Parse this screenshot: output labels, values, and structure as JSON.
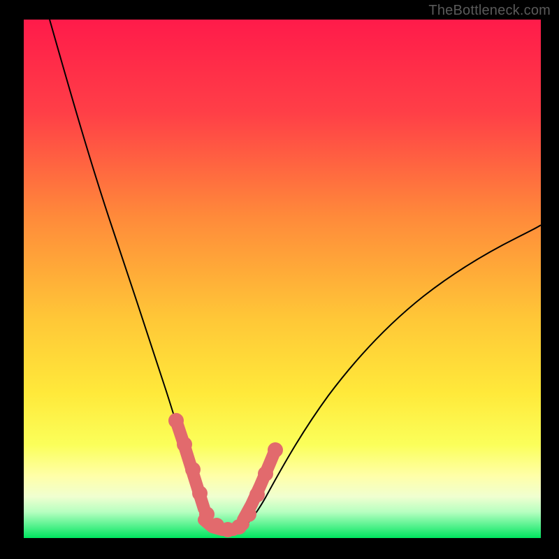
{
  "watermark": "TheBottleneck.com",
  "colors": {
    "gradient_top": "#ff1b4a",
    "gradient_mid_upper": "#ff8a3a",
    "gradient_mid": "#ffde35",
    "gradient_lower_yellow": "#ffff8a",
    "gradient_green_pale": "#b6ffc0",
    "gradient_green": "#00e55f",
    "curve": "#000000",
    "overlay": "#e26a6d",
    "frame": "#000000"
  },
  "chart_data": {
    "type": "line",
    "title": "",
    "xlabel": "",
    "ylabel": "",
    "x_range": [
      0,
      100
    ],
    "y_range": [
      0,
      100
    ],
    "note": "Bottleneck-style V curve. y≈100 is top (red, high bottleneck), y≈0 is bottom (green, no bottleneck). Minimum around x≈37.",
    "series": [
      {
        "name": "bottleneck_curve",
        "x": [
          5,
          8,
          12,
          16,
          20,
          24,
          28,
          30,
          32,
          34,
          36,
          38,
          40,
          42,
          44,
          48,
          54,
          60,
          68,
          76,
          84,
          92,
          100
        ],
        "y": [
          100,
          89,
          76,
          64,
          52,
          41,
          29,
          23,
          17,
          10,
          4,
          1,
          1,
          3,
          7,
          14,
          22,
          29,
          36,
          42,
          47,
          51,
          55
        ]
      }
    ],
    "highlight_region": {
      "description": "Pink/coral thick overlay near the valley of the curve indicating the optimal match zone.",
      "left_segment_x": [
        30,
        36
      ],
      "bottom_segment_x": [
        34,
        42
      ],
      "right_segment_x": [
        42,
        46
      ]
    }
  }
}
